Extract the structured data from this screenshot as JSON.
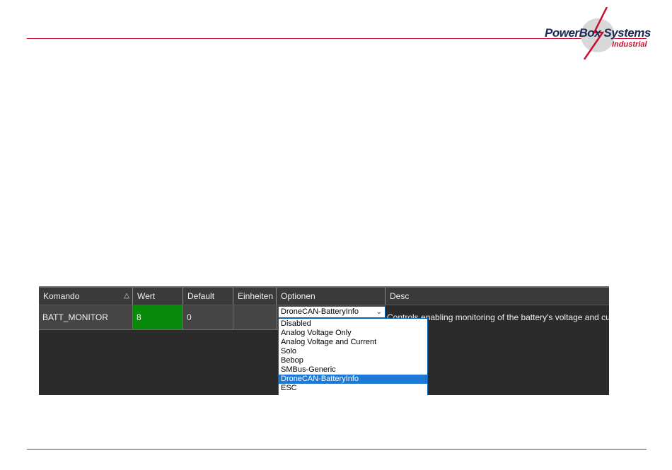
{
  "logo": {
    "name": "PowerBox Systems",
    "sub": "Industrial",
    "brand_blue": "#1b2a55",
    "brand_red": "#c8102e"
  },
  "grid": {
    "columns": [
      {
        "label": "Komando",
        "sort_icon": "sort-ascending-icon"
      },
      {
        "label": "Wert"
      },
      {
        "label": "Default"
      },
      {
        "label": "Einheiten"
      },
      {
        "label": "Optionen"
      },
      {
        "label": "Desc"
      }
    ],
    "row": {
      "command": "BATT_MONITOR",
      "value": "8",
      "default": "0",
      "units": "",
      "option_selected": "DroneCAN-BatteryInfo",
      "desc": "Controls enabling monitoring of the battery's voltage and current"
    },
    "value_cell_color": "#0a8a0a"
  },
  "dropdown": {
    "options": [
      "Disabled",
      "Analog Voltage Only",
      "Analog Voltage and Current",
      "Solo",
      "Bebop",
      "SMBus-Generic",
      "DroneCAN-BatteryInfo",
      "ESC"
    ],
    "highlighted": "DroneCAN-BatteryInfo"
  }
}
